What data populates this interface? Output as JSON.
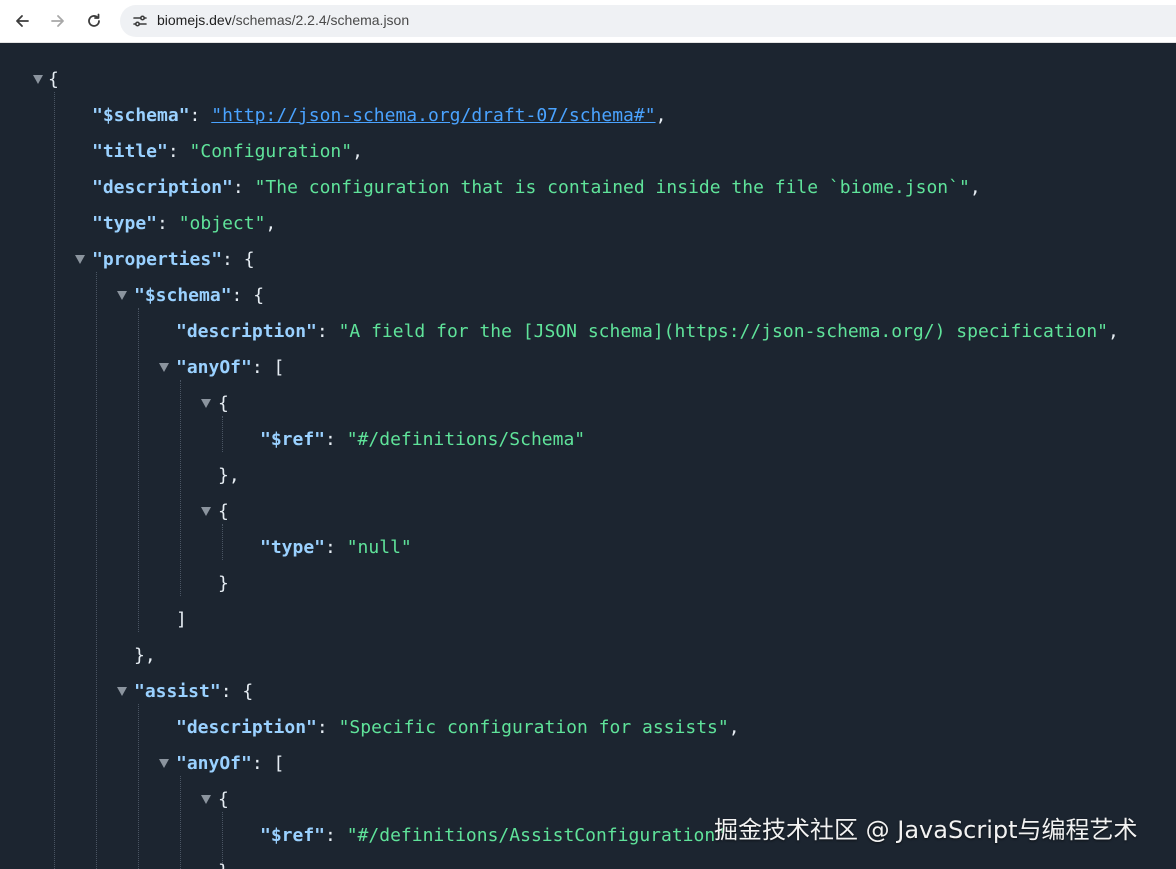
{
  "browser": {
    "url_host": "biomejs.dev",
    "url_path": "/schemas/2.2.4/schema.json",
    "icons": [
      "back-arrow-icon",
      "forward-arrow-icon",
      "reload-icon",
      "site-info-icon"
    ]
  },
  "json": {
    "open_root": "{",
    "schema_key": "\"$schema\"",
    "schema_value": "\"http://json-schema.org/draft-07/schema#\"",
    "title_key": "\"title\"",
    "title_value": "\"Configuration\"",
    "description_key": "\"description\"",
    "description_value": "\"The configuration that is contained inside the file `biome.json`\"",
    "type_key": "\"type\"",
    "type_value": "\"object\"",
    "properties_key": "\"properties\"",
    "prop_schema_key": "\"$schema\"",
    "prop_schema_desc_key": "\"description\"",
    "prop_schema_desc_value": "\"A field for the [JSON schema](https://json-schema.org/) specification\"",
    "anyof_key": "\"anyOf\"",
    "ref_key": "\"$ref\"",
    "ref_schema_value": "\"#/definitions/Schema\"",
    "type_null_key": "\"type\"",
    "type_null_value": "\"null\"",
    "assist_key": "\"assist\"",
    "assist_desc_key": "\"description\"",
    "assist_desc_value": "\"Specific configuration for assists\"",
    "assist_anyof_key": "\"anyOf\"",
    "assist_ref_key": "\"$ref\"",
    "assist_ref_value": "\"#/definitions/AssistConfiguration\""
  },
  "watermark": "掘金技术社区 @ JavaScript与编程艺术",
  "colors": {
    "background": "#1c2530",
    "key": "#9ad1ff",
    "string": "#5fe39a",
    "link": "#4aa3ff",
    "punctuation": "#e6edf3"
  }
}
